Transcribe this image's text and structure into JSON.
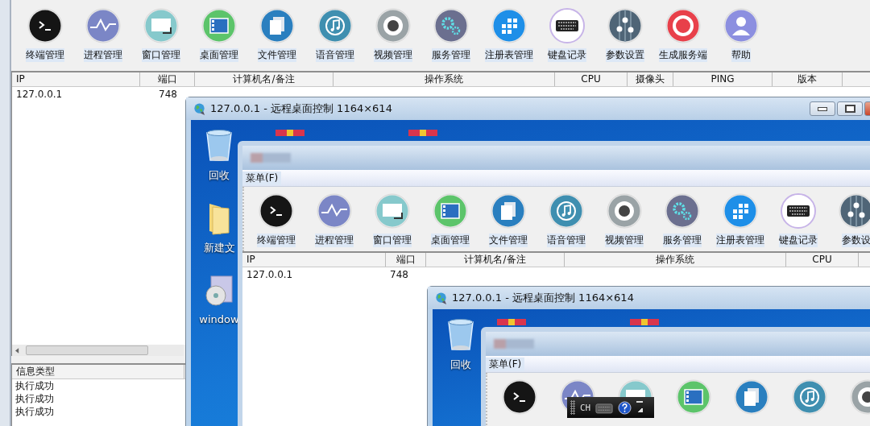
{
  "toolbar": [
    {
      "label": "终端管理",
      "kind": "terminal"
    },
    {
      "label": "进程管理",
      "kind": "process"
    },
    {
      "label": "窗口管理",
      "kind": "window"
    },
    {
      "label": "桌面管理",
      "kind": "desktop"
    },
    {
      "label": "文件管理",
      "kind": "file"
    },
    {
      "label": "语音管理",
      "kind": "audio"
    },
    {
      "label": "视频管理",
      "kind": "video"
    },
    {
      "label": "服务管理",
      "kind": "service"
    },
    {
      "label": "注册表管理",
      "kind": "registry"
    },
    {
      "label": "键盘记录",
      "kind": "keyboard"
    },
    {
      "label": "参数设置",
      "kind": "settings"
    },
    {
      "label": "生成服务端",
      "kind": "build"
    },
    {
      "label": "帮助",
      "kind": "help"
    }
  ],
  "hosts_table": {
    "columns": [
      "IP",
      "端口",
      "计算机名/备注",
      "操作系统",
      "CPU",
      "摄像头",
      "PING",
      "版本"
    ],
    "rows": [
      [
        "127.0.0.1",
        "748"
      ]
    ]
  },
  "log": {
    "columns": [
      "信息类型"
    ],
    "rows": [
      "执行成功",
      "执行成功",
      "执行成功"
    ]
  },
  "remote_window": {
    "title": "127.0.0.1 - 远程桌面控制 1164×614",
    "desktop_icons": [
      {
        "label": "回收",
        "kind": "bin"
      },
      {
        "label": "新建文",
        "kind": "folder"
      },
      {
        "label": "window",
        "kind": "disc"
      }
    ],
    "app": {
      "menu": "菜单(F)",
      "toolbar": [
        {
          "label": "终端管理",
          "kind": "terminal"
        },
        {
          "label": "进程管理",
          "kind": "process"
        },
        {
          "label": "窗口管理",
          "kind": "window"
        },
        {
          "label": "桌面管理",
          "kind": "desktop"
        },
        {
          "label": "文件管理",
          "kind": "file"
        },
        {
          "label": "语音管理",
          "kind": "audio"
        },
        {
          "label": "视频管理",
          "kind": "video"
        },
        {
          "label": "服务管理",
          "kind": "service"
        },
        {
          "label": "注册表管理",
          "kind": "registry"
        },
        {
          "label": "键盘记录",
          "kind": "keyboard"
        },
        {
          "label": "参数设",
          "kind": "settings"
        }
      ],
      "table": {
        "columns": [
          "IP",
          "端口",
          "计算机名/备注",
          "操作系统",
          "CPU"
        ],
        "rows": [
          [
            "127.0.0.1",
            "748"
          ]
        ]
      },
      "remote_window": {
        "title": "127.0.0.1 - 远程桌面控制 1164×614",
        "desktop_icons": [
          {
            "label": "回收",
            "kind": "bin"
          }
        ],
        "app": {
          "menu": "菜单(F)",
          "toolbar": [
            {
              "kind": "terminal"
            },
            {
              "kind": "process"
            },
            {
              "kind": "window"
            },
            {
              "kind": "desktop"
            },
            {
              "kind": "file"
            },
            {
              "kind": "audio"
            },
            {
              "kind": "video"
            }
          ]
        },
        "ime_bar": {
          "label": "CH"
        }
      }
    }
  }
}
